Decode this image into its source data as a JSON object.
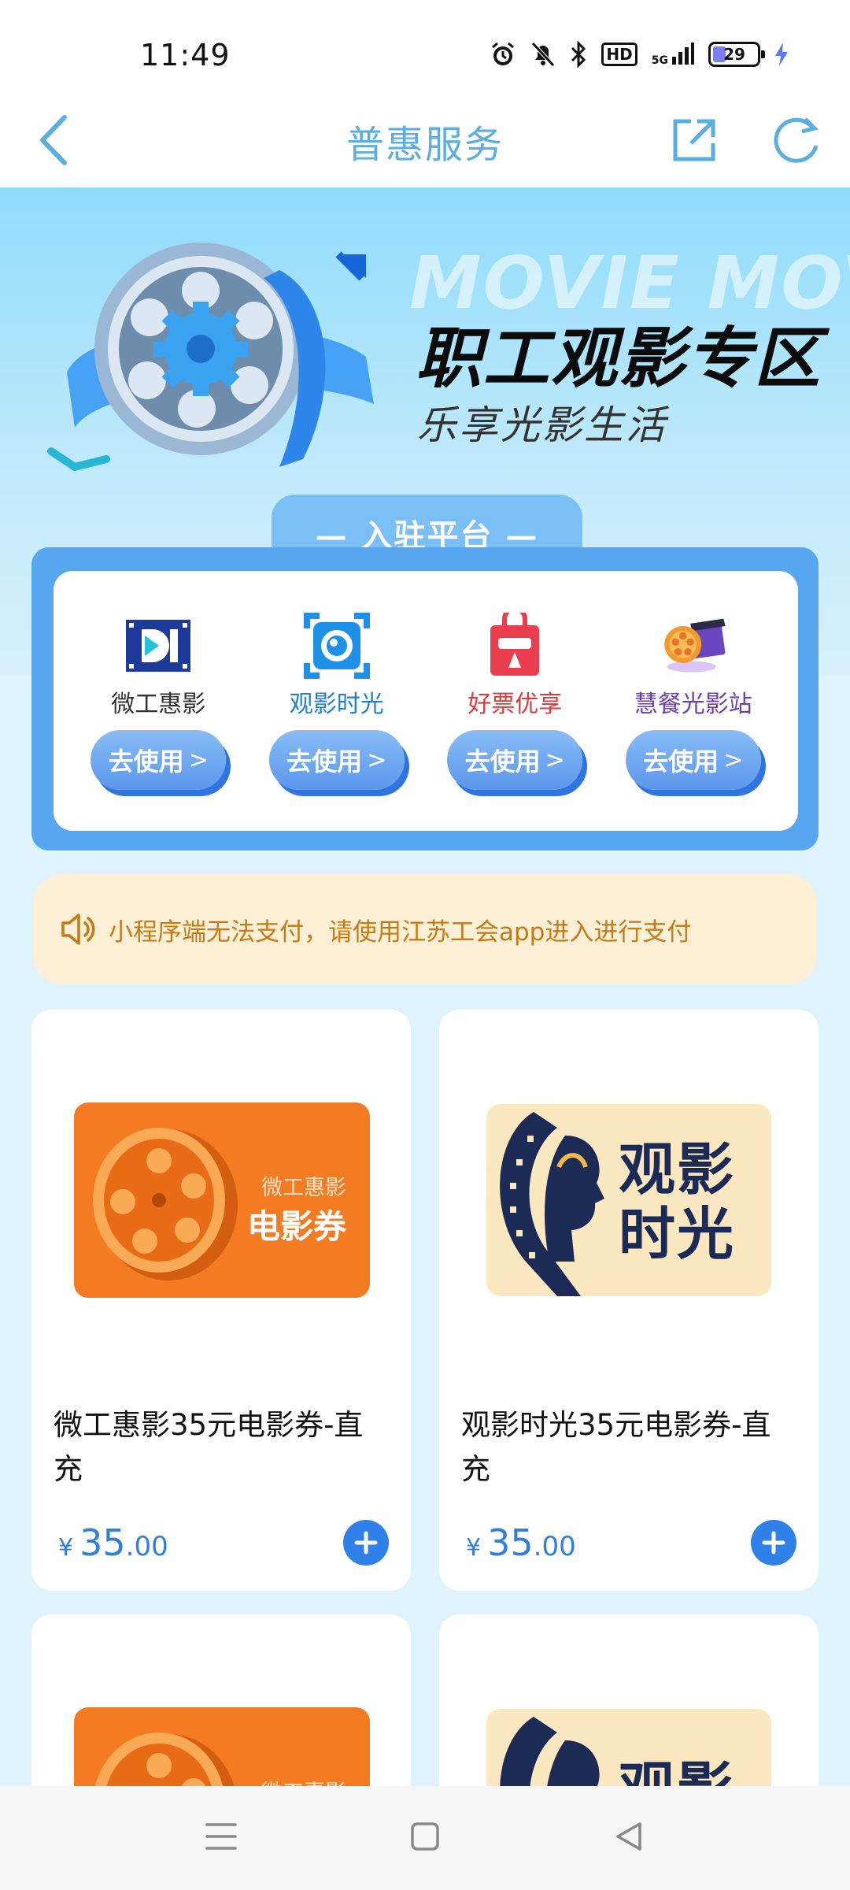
{
  "status_bar": {
    "time": "11:49",
    "network": "5G",
    "hd": "HD",
    "battery": "29"
  },
  "nav": {
    "title": "普惠服务"
  },
  "hero": {
    "background_text": "MOVIE MOVIE",
    "title": "职工观影专区",
    "subtitle": "乐享光影生活"
  },
  "platforms": {
    "heading": "— 入驻平台 —",
    "items": [
      {
        "name": "微工惠影",
        "button": "去使用",
        "arrow": ">",
        "color": "#333333"
      },
      {
        "name": "观影时光",
        "button": "去使用",
        "arrow": ">",
        "color": "#1e7fd8"
      },
      {
        "name": "好票优享",
        "button": "去使用",
        "arrow": ">",
        "color": "#e23a3a"
      },
      {
        "name": "慧餐光影站",
        "button": "去使用",
        "arrow": ">",
        "color": "#6a3fb5"
      }
    ]
  },
  "notice": {
    "text": "小程序端无法支付，请使用江苏工会app进入进行支付"
  },
  "products": [
    {
      "image_caption_small": "微工惠影",
      "image_caption_big": "电影券",
      "title": "微工惠影35元电影券-直充",
      "currency": "¥",
      "price_int": "35",
      "price_dec": ".00"
    },
    {
      "image_caption_big": "观影时光",
      "title": "观影时光35元电影券-直充",
      "currency": "¥",
      "price_int": "35",
      "price_dec": ".00"
    },
    {
      "image_caption_small": "微工惠影"
    },
    {
      "image_caption_big": "观影"
    }
  ],
  "colors": {
    "accent": "#2f80e8",
    "nav_title": "#5aaee0",
    "notice_text": "#c77a14",
    "notice_bg": "#fdf0d6"
  }
}
